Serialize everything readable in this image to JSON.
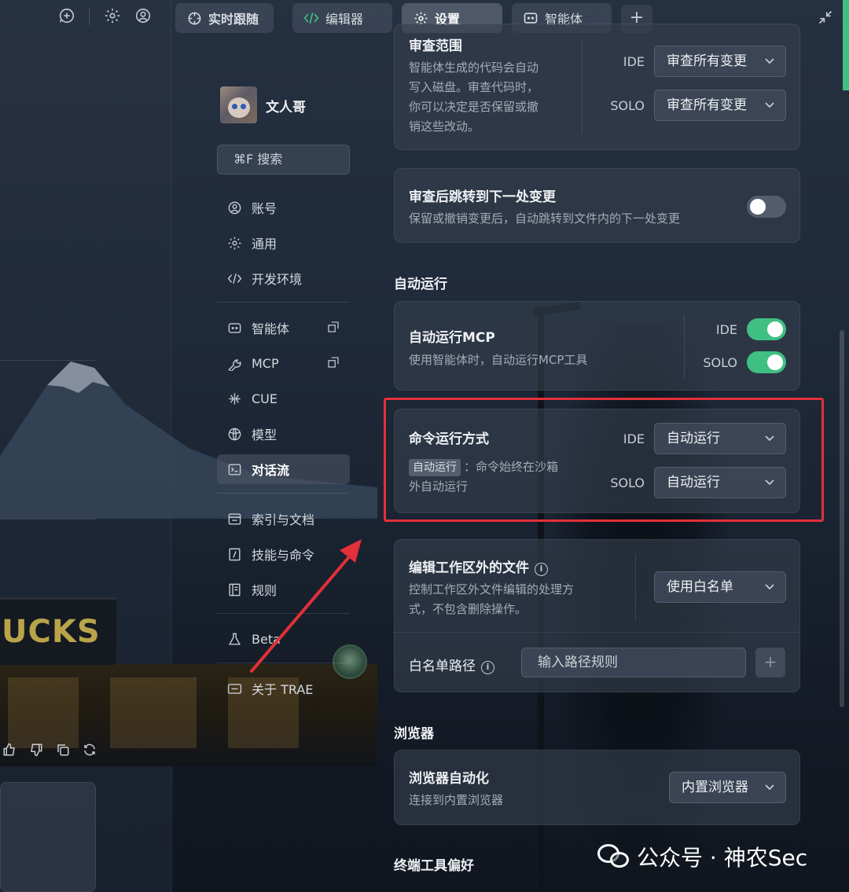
{
  "window": {
    "tabs": [
      {
        "label": "实时跟随",
        "icon": "crosshair-icon"
      },
      {
        "label": "编辑器",
        "icon": "code-icon"
      },
      {
        "label": "设置",
        "icon": "gear-icon"
      },
      {
        "label": "智能体",
        "icon": "bot-icon"
      }
    ],
    "add_tab": "+"
  },
  "sidebar": {
    "profile_name": "文人哥",
    "search_placeholder": "⌘F 搜索",
    "items": [
      {
        "label": "账号",
        "icon": "user-circle-icon"
      },
      {
        "label": "通用",
        "icon": "gear-icon"
      },
      {
        "label": "开发环境",
        "icon": "code-icon"
      },
      {
        "label": "智能体",
        "icon": "bot-icon"
      },
      {
        "label": "MCP",
        "icon": "wrench-icon"
      },
      {
        "label": "CUE",
        "icon": "cue-icon"
      },
      {
        "label": "模型",
        "icon": "model-icon"
      },
      {
        "label": "对话流",
        "icon": "terminal-icon"
      },
      {
        "label": "索引与文档",
        "icon": "index-icon"
      },
      {
        "label": "技能与命令",
        "icon": "slash-icon"
      },
      {
        "label": "规则",
        "icon": "rules-icon"
      },
      {
        "label": "Beta",
        "icon": "flask-icon"
      },
      {
        "label": "关于 TRAE",
        "icon": "about-icon"
      }
    ]
  },
  "review_scope": {
    "title": "审查范围",
    "desc_lines": [
      "智能体生成的代码会自动",
      "写入磁盘。审查代码时，",
      "你可以决定是否保留或撤",
      "销这些改动。"
    ],
    "ide_label": "IDE",
    "ide_value": "审查所有变更",
    "solo_label": "SOLO",
    "solo_value": "审查所有变更"
  },
  "jump_after_review": {
    "title": "审查后跳转到下一处变更",
    "desc": "保留或撤销变更后，自动跳转到文件内的下一处变更",
    "enabled": false
  },
  "auto_run": {
    "section_title": "自动运行",
    "mcp": {
      "title": "自动运行MCP",
      "desc": "使用智能体时，自动运行MCP工具",
      "ide_label": "IDE",
      "solo_label": "SOLO",
      "ide_enabled": true,
      "solo_enabled": true
    },
    "command": {
      "title": "命令运行方式",
      "tag": "自动运行",
      "desc_rest": "：命令始终在沙箱",
      "desc_line2": "外自动运行",
      "ide_label": "IDE",
      "ide_value": "自动运行",
      "solo_label": "SOLO",
      "solo_value": "自动运行"
    },
    "outside_files": {
      "title": "编辑工作区外的文件",
      "desc_lines": [
        "控制工作区外文件编辑的处理方",
        "式，不包含删除操作。"
      ],
      "value": "使用白名单"
    },
    "whitelist": {
      "label": "白名单路径",
      "placeholder": "输入路径规则",
      "add": "+"
    }
  },
  "browser": {
    "section_title": "浏览器",
    "automation_title": "浏览器自动化",
    "automation_desc": "连接到内置浏览器",
    "value": "内置浏览器"
  },
  "terminal": {
    "section_title": "终端工具偏好"
  },
  "background": {
    "store_sign": "UCKS"
  },
  "watermark": {
    "text": "公众号 · 神农Sec"
  },
  "colors": {
    "accent_green": "#3fbf82",
    "highlight_red": "#e3303a"
  }
}
